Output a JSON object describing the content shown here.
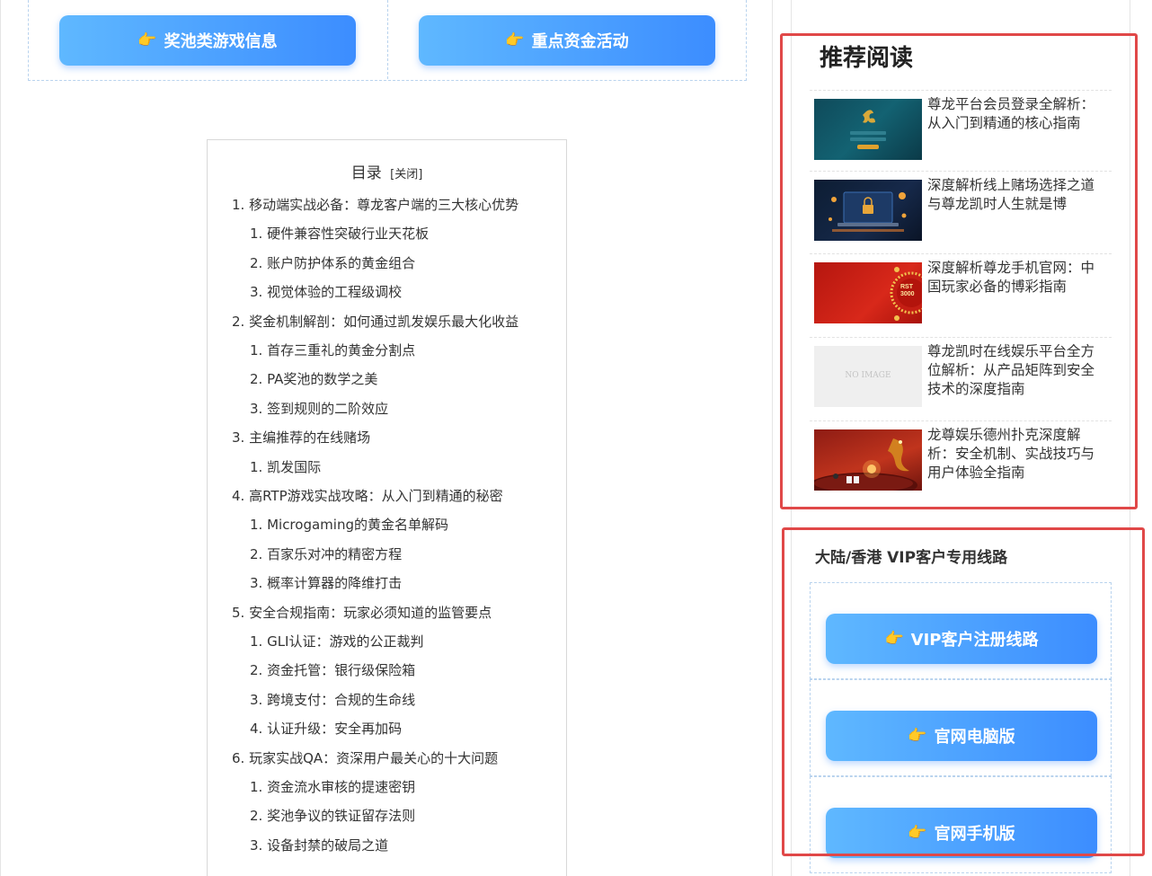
{
  "top_buttons": {
    "jackpot_label": "奖池类游戏信息",
    "funds_label": "重点资金活动",
    "icon": "pointing-hand-icon"
  },
  "toc": {
    "title": "目录",
    "toggle": "[关闭]",
    "items": [
      {
        "level": 1,
        "text": "1. 移动端实战必备：尊龙客户端的三大核心优势"
      },
      {
        "level": 2,
        "text": "1. 硬件兼容性突破行业天花板"
      },
      {
        "level": 2,
        "text": "2. 账户防护体系的黄金组合"
      },
      {
        "level": 2,
        "text": "3. 视觉体验的工程级调校"
      },
      {
        "level": 1,
        "text": "2. 奖金机制解剖：如何通过凯发娱乐最大化收益"
      },
      {
        "level": 2,
        "text": "1. 首存三重礼的黄金分割点"
      },
      {
        "level": 2,
        "text": "2. PA奖池的数学之美"
      },
      {
        "level": 2,
        "text": "3. 签到规则的二阶效应"
      },
      {
        "level": 1,
        "text": "3. 主编推荐的在线赌场"
      },
      {
        "level": 2,
        "text": "1. 凯发国际"
      },
      {
        "level": 1,
        "text": "4. 高RTP游戏实战攻略：从入门到精通的秘密"
      },
      {
        "level": 2,
        "text": "1. Microgaming的黄金名单解码"
      },
      {
        "level": 2,
        "text": "2. 百家乐对冲的精密方程"
      },
      {
        "level": 2,
        "text": "3. 概率计算器的降维打击"
      },
      {
        "level": 1,
        "text": "5. 安全合规指南：玩家必须知道的监管要点"
      },
      {
        "level": 2,
        "text": "1. GLI认证：游戏的公正裁判"
      },
      {
        "level": 2,
        "text": "2. 资金托管：银行级保险箱"
      },
      {
        "level": 2,
        "text": "3. 跨境支付：合规的生命线"
      },
      {
        "level": 2,
        "text": "4. 认证升级：安全再加码"
      },
      {
        "level": 1,
        "text": "6. 玩家实战QA：资深用户最关心的十大问题"
      },
      {
        "level": 2,
        "text": "1. 资金流水审核的提速密钥"
      },
      {
        "level": 2,
        "text": "2. 奖池争议的铁证留存法则"
      },
      {
        "level": 2,
        "text": "3. 设备封禁的破局之道"
      }
    ]
  },
  "recommended": {
    "title": "推荐阅读",
    "items": [
      {
        "text": "尊龙平台会员登录全解析：从入门到精通的核心指南",
        "thumb": "dragon-login-thumbnail"
      },
      {
        "text": "深度解析线上赌场选择之道与尊龙凯时人生就是博",
        "thumb": "laptop-lock-thumbnail"
      },
      {
        "text": "深度解析尊龙手机官网：中国玩家必备的博彩指南",
        "thumb": "red-bonus-thumbnail",
        "badge": "RST 3000"
      },
      {
        "text": "尊龙凯时在线娱乐平台全方位解析：从产品矩阵到安全技术的深度指南",
        "thumb": "no-image-thumbnail",
        "placeholder": "NO IMAGE"
      },
      {
        "text": "龙尊娱乐德州扑克深度解析：安全机制、实战技巧与用户体验全指南",
        "thumb": "dragon-poker-thumbnail"
      }
    ]
  },
  "vip": {
    "title": "大陆/香港 VIP客户专用线路",
    "buttons": [
      {
        "label": "VIP客户注册线路"
      },
      {
        "label": "官网电脑版"
      },
      {
        "label": "官网手机版"
      }
    ]
  },
  "colors": {
    "button_gradient_start": "#5fb8ff",
    "button_gradient_end": "#3c8dff",
    "highlight_box": "#e04848",
    "hand_icon": "#f5a623"
  }
}
